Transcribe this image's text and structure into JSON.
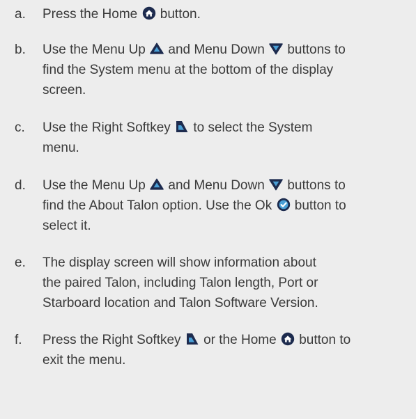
{
  "steps": [
    {
      "letter": "a.",
      "lines": [
        [
          {
            "t": "Press the Home "
          },
          {
            "icon": "home-icon"
          },
          {
            "t": " button."
          }
        ]
      ]
    },
    {
      "letter": "b.",
      "lines": [
        [
          {
            "t": "Use the Menu Up "
          },
          {
            "icon": "menu-up-icon"
          },
          {
            "t": " and Menu Down "
          },
          {
            "icon": "menu-down-icon"
          },
          {
            "t": " buttons to"
          }
        ],
        [
          {
            "t": "find the System menu at the bottom of the display"
          }
        ],
        [
          {
            "t": "screen."
          }
        ]
      ]
    },
    {
      "letter": "c.",
      "lines": [
        [
          {
            "t": "Use the Right Softkey "
          },
          {
            "icon": "right-softkey-icon"
          },
          {
            "t": " to select the System"
          }
        ],
        [
          {
            "t": "menu."
          }
        ]
      ]
    },
    {
      "letter": "d.",
      "lines": [
        [
          {
            "t": "Use the Menu Up "
          },
          {
            "icon": "menu-up-icon"
          },
          {
            "t": " and Menu Down "
          },
          {
            "icon": "menu-down-icon"
          },
          {
            "t": " buttons to"
          }
        ],
        [
          {
            "t": "find the About Talon option. Use the Ok "
          },
          {
            "icon": "ok-icon"
          },
          {
            "t": " button to"
          }
        ],
        [
          {
            "t": "select it."
          }
        ]
      ]
    },
    {
      "letter": "e.",
      "lines": [
        [
          {
            "t": "The display screen will show information about"
          }
        ],
        [
          {
            "t": "the paired Talon, including Talon length, Port or"
          }
        ],
        [
          {
            "t": "Starboard location and Talon Software Version."
          }
        ]
      ]
    },
    {
      "letter": "f.",
      "lines": [
        [
          {
            "t": "Press the Right Softkey "
          },
          {
            "icon": "right-softkey-icon"
          },
          {
            "t": " or the Home "
          },
          {
            "icon": "home-icon"
          },
          {
            "t": " button to"
          }
        ],
        [
          {
            "t": "exit the menu."
          }
        ]
      ]
    }
  ],
  "colors": {
    "text": "#3a3a3a",
    "background": "#ededed",
    "icon_fill": "#1d2b4e",
    "icon_accent": "#4a9fd6"
  }
}
